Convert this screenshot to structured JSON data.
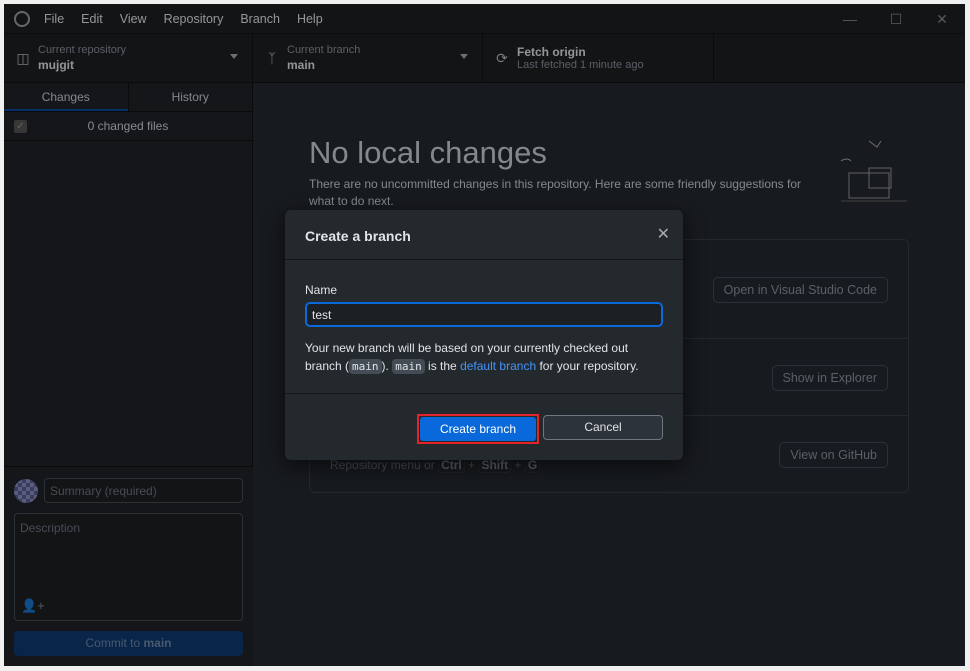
{
  "menu": [
    "File",
    "Edit",
    "View",
    "Repository",
    "Branch",
    "Help"
  ],
  "toolbar": {
    "repo": {
      "label": "Current repository",
      "value": "mujgit"
    },
    "branch": {
      "label": "Current branch",
      "value": "main"
    },
    "fetch": {
      "label": "Fetch origin",
      "sub": "Last fetched 1 minute ago"
    }
  },
  "sidebar": {
    "tabs": [
      "Changes",
      "History"
    ],
    "changed": "0 changed files",
    "summary_placeholder": "Summary (required)",
    "description_placeholder": "Description",
    "commit_prefix": "Commit to ",
    "commit_branch": "main"
  },
  "main": {
    "title": "No local changes",
    "subtitle": "There are no uncommitted changes in this repository. Here are some friendly suggestions for what to do next.",
    "buttons": [
      "Open in Visual Studio Code",
      "Show in Explorer",
      "View on GitHub"
    ],
    "hint": {
      "prefix": "Repository menu or",
      "k1": "Ctrl",
      "k2": "Shift",
      "k3": "G",
      "plus": "+"
    }
  },
  "dialog": {
    "title": "Create a branch",
    "name_label": "Name",
    "name_value": "test",
    "info1": "Your new branch will be based on your currently checked out branch (",
    "code1": "main",
    "info2": "). ",
    "code2": "main",
    "info3": " is the ",
    "link": "default branch",
    "info4": " for your repository.",
    "create": "Create branch",
    "cancel": "Cancel"
  },
  "colors": {
    "accent": "#0969da",
    "highlight": "#e3242b"
  }
}
